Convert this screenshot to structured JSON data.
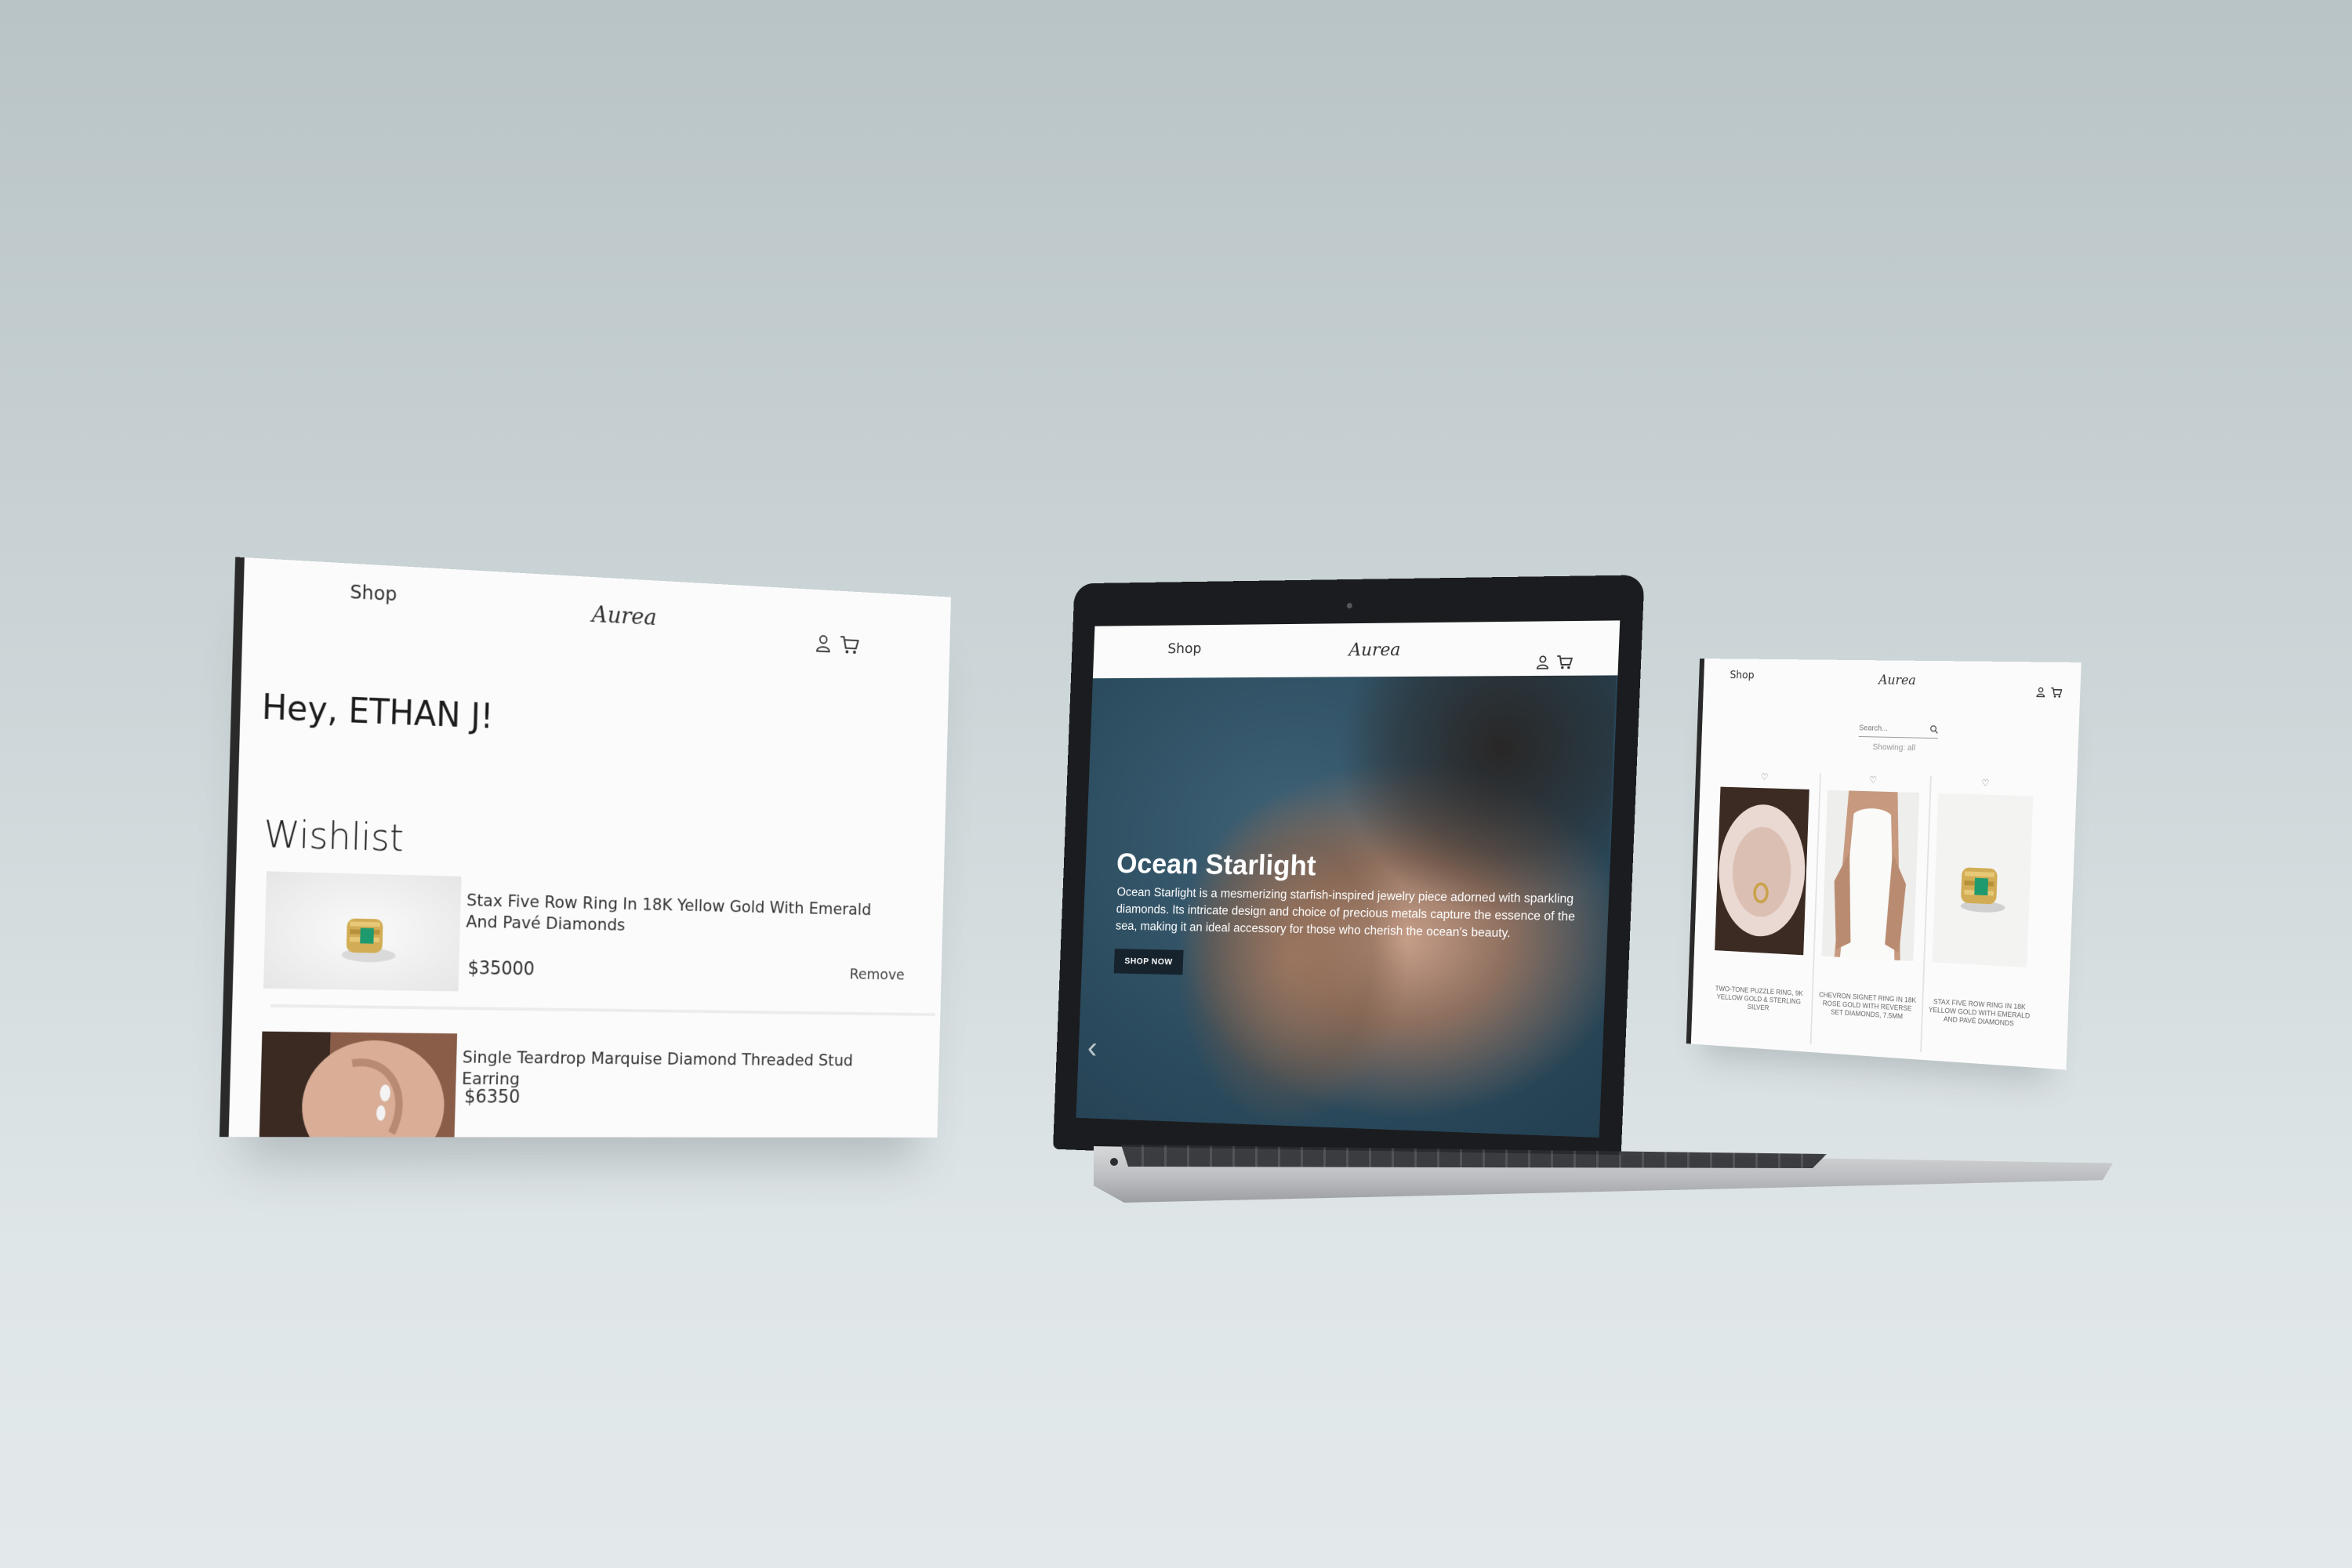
{
  "brand": {
    "logo_text": "Aurea",
    "nav_shop": "Shop"
  },
  "wishlist_page": {
    "greeting": "Hey, ETHAN J!",
    "section_title": "Wishlist",
    "items": [
      {
        "name": "Stax Five Row Ring In 18K Yellow Gold With Emerald And Pavé Diamonds",
        "price": "$35000",
        "remove_label": "Remove"
      },
      {
        "name": "Single Teardrop Marquise Diamond Threaded Stud Earring",
        "price": "$6350"
      }
    ]
  },
  "home_page": {
    "hero_title": "Ocean Starlight",
    "hero_text": "Ocean Starlight is a mesmerizing starfish-inspired jewelry piece adorned with sparkling diamonds. Its intricate design and choice of precious metals capture the essence of the sea, making it an ideal accessory for those who cherish the ocean's beauty.",
    "hero_button": "SHOP NOW"
  },
  "shop_page": {
    "search_placeholder": "Search...",
    "showing_text": "Showing: all",
    "products": [
      {
        "name": "TWO-TONE PUZZLE RING, 9K YELLOW GOLD & STERLING SILVER"
      },
      {
        "name": "CHEVRON SIGNET RING IN 18K ROSE GOLD WITH REVERSE SET DIAMONDS, 7.5MM"
      },
      {
        "name": "STAX FIVE ROW RING IN 18K YELLOW GOLD WITH EMERALD AND PAVÉ DIAMONDS"
      }
    ]
  },
  "colors": {
    "accent_dark": "#16232d",
    "panel_bg": "#fbfbfb",
    "emerald": "#1f9a6e",
    "gold": "#c9a34a"
  },
  "icons": [
    "user-icon",
    "cart-icon",
    "search-icon",
    "heart-icon",
    "chevron-left-icon"
  ]
}
